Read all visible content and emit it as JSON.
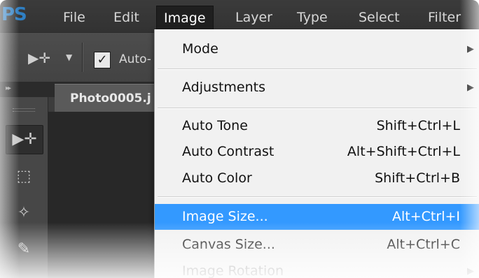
{
  "app": {
    "logo": "PS"
  },
  "menubar": {
    "items": [
      {
        "label": "File"
      },
      {
        "label": "Edit"
      },
      {
        "label": "Image"
      },
      {
        "label": "Layer"
      },
      {
        "label": "Type"
      },
      {
        "label": "Select"
      },
      {
        "label": "Filter"
      }
    ],
    "active": "Image"
  },
  "options_bar": {
    "move_tool_icon": "move-tool-icon",
    "auto_select_checked": true,
    "auto_select_label": "Auto-"
  },
  "document": {
    "tab_label": "Photo0005.j"
  },
  "image_menu": {
    "items": [
      {
        "label": "Mode",
        "shortcut": "",
        "submenu": true
      },
      {
        "label": "Adjustments",
        "shortcut": "",
        "submenu": true
      },
      {
        "label": "Auto Tone",
        "shortcut": "Shift+Ctrl+L",
        "submenu": false
      },
      {
        "label": "Auto Contrast",
        "shortcut": "Alt+Shift+Ctrl+L",
        "submenu": false
      },
      {
        "label": "Auto Color",
        "shortcut": "Shift+Ctrl+B",
        "submenu": false
      },
      {
        "label": "Image Size...",
        "shortcut": "Alt+Ctrl+I",
        "submenu": false,
        "highlighted": true
      },
      {
        "label": "Canvas Size...",
        "shortcut": "Alt+Ctrl+C",
        "submenu": false
      },
      {
        "label": "Image Rotation",
        "shortcut": "",
        "submenu": true
      }
    ]
  },
  "colors": {
    "highlight": "#3399ff",
    "menu_bg": "#f1f1f1",
    "chrome": "#3c3c3c"
  }
}
